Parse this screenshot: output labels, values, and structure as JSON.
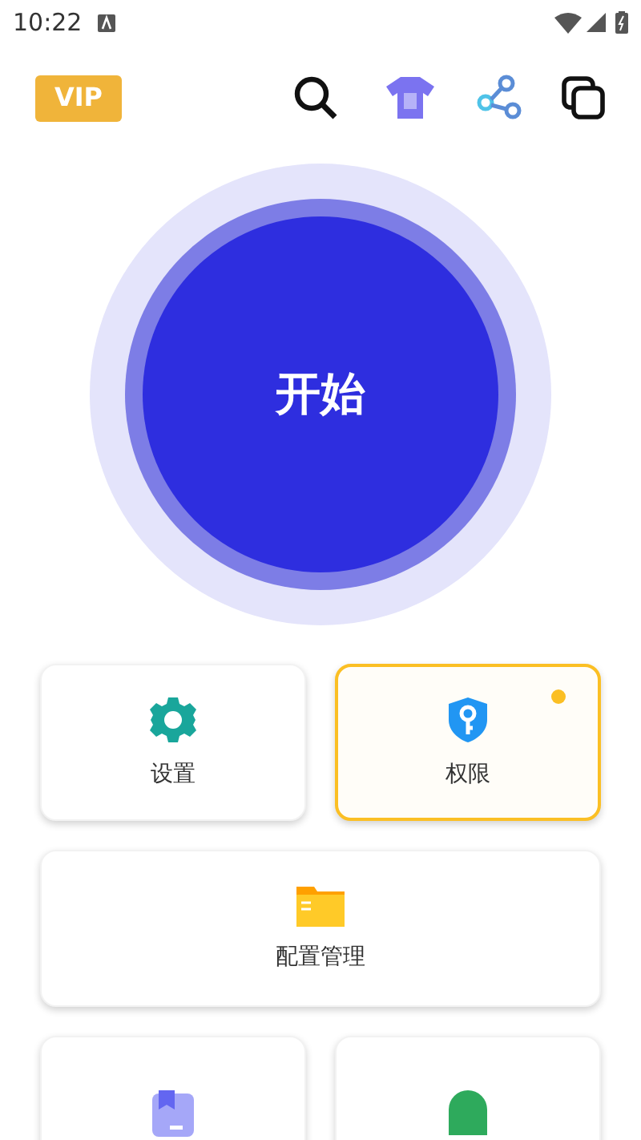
{
  "status_bar": {
    "time": "10:22"
  },
  "header": {
    "vip_badge": "VIP"
  },
  "start_button": {
    "label": "开始"
  },
  "cards": [
    {
      "kind": "half",
      "label": "设置",
      "attention": false
    },
    {
      "kind": "half",
      "label": "权限",
      "attention": true
    },
    {
      "kind": "wide",
      "label": "配置管理",
      "attention": false
    },
    {
      "kind": "half",
      "attention": false
    },
    {
      "kind": "half",
      "attention": false
    }
  ]
}
